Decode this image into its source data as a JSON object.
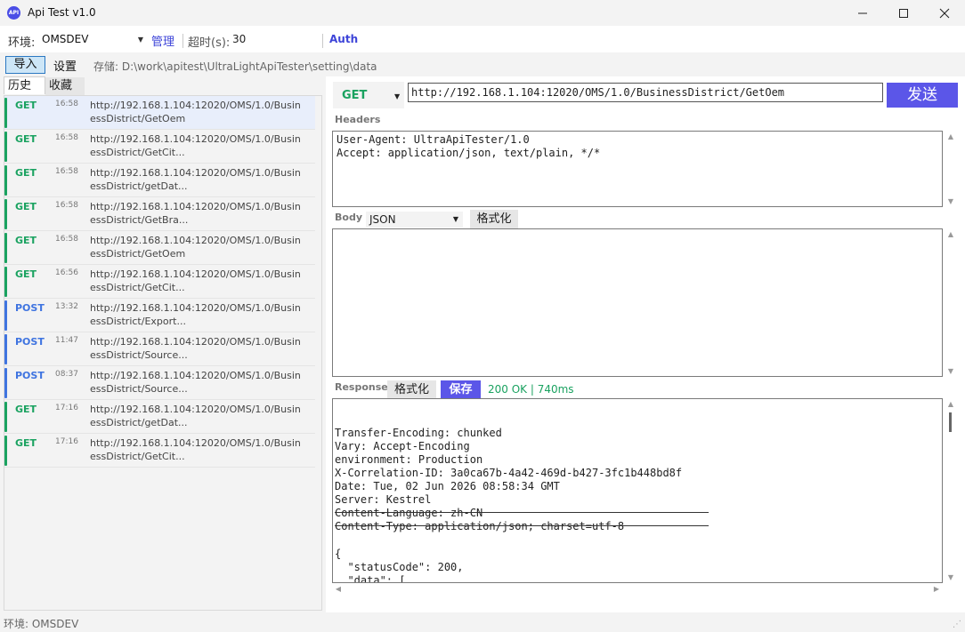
{
  "window": {
    "title": "Api Test v1.0",
    "app_icon": "API"
  },
  "toolbar": {
    "env_label": "环境:",
    "env_value": "OMSDEV",
    "manage_label": "管理",
    "timeout_label": "超时(s):",
    "timeout_value": "30",
    "auth_label": "Auth",
    "import_label": "导入",
    "settings_label": "设置",
    "storage_text": "存储: D:\\work\\apitest\\UltraLightApiTester\\setting\\data"
  },
  "tabs": {
    "history": "历史",
    "favorites": "收藏"
  },
  "colors": {
    "get": "#1aa260",
    "post": "#3f74e0",
    "accent": "#5b56e8"
  },
  "history": [
    {
      "method": "GET",
      "time": "16:58",
      "url": "http://192.168.1.104:12020/OMS/1.0/BusinessDistrict/GetOem"
    },
    {
      "method": "GET",
      "time": "16:58",
      "url": "http://192.168.1.104:12020/OMS/1.0/BusinessDistrict/GetCit..."
    },
    {
      "method": "GET",
      "time": "16:58",
      "url": "http://192.168.1.104:12020/OMS/1.0/BusinessDistrict/getDat..."
    },
    {
      "method": "GET",
      "time": "16:58",
      "url": "http://192.168.1.104:12020/OMS/1.0/BusinessDistrict/GetBra..."
    },
    {
      "method": "GET",
      "time": "16:58",
      "url": "http://192.168.1.104:12020/OMS/1.0/BusinessDistrict/GetOem"
    },
    {
      "method": "GET",
      "time": "16:56",
      "url": "http://192.168.1.104:12020/OMS/1.0/BusinessDistrict/GetCit..."
    },
    {
      "method": "POST",
      "time": "13:32",
      "url": "http://192.168.1.104:12020/OMS/1.0/BusinessDistrict/Export..."
    },
    {
      "method": "POST",
      "time": "11:47",
      "url": "http://192.168.1.104:12020/OMS/1.0/BusinessDistrict/Source..."
    },
    {
      "method": "POST",
      "time": "08:37",
      "url": "http://192.168.1.104:12020/OMS/1.0/BusinessDistrict/Source..."
    },
    {
      "method": "GET",
      "time": "17:16",
      "url": "http://192.168.1.104:12020/OMS/1.0/BusinessDistrict/getDat..."
    },
    {
      "method": "GET",
      "time": "17:16",
      "url": "http://192.168.1.104:12020/OMS/1.0/BusinessDistrict/GetCit..."
    }
  ],
  "request": {
    "method": "GET",
    "url": "http://192.168.1.104:12020/OMS/1.0/BusinessDistrict/GetOem",
    "send_label": "发送",
    "headers_label": "Headers",
    "headers_text": "User-Agent: UltraApiTester/1.0\nAccept: application/json, text/plain, */*",
    "body_label": "Body",
    "body_type": "JSON",
    "body_format_label": "格式化",
    "body_text": ""
  },
  "response": {
    "label": "Response",
    "format_label": "格式化",
    "save_label": "保存",
    "status": "200 OK | 740ms",
    "headers_text": "Transfer-Encoding: chunked\nVary: Accept-Encoding\nenvironment: Production\nX-Correlation-ID: 3a0ca67b-4a42-469d-b427-3fc1b448bd8f\nDate: Tue, 02 Jun 2026 08:58:34 GMT\nServer: Kestrel\nContent-Language: zh-CN\nContent-Type: application/json; charset=utf-8",
    "body_text": "{\n  \"statusCode\": 200,\n  \"data\": ["
  },
  "statusbar": {
    "text": "环境: OMSDEV"
  }
}
